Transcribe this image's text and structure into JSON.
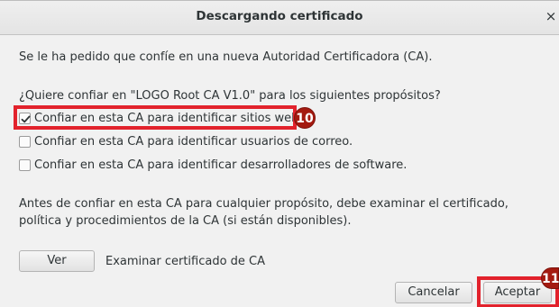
{
  "dialog": {
    "title": "Descargando certificado",
    "close_label": "×",
    "intro": "Se le ha pedido que confíe en una nueva Autoridad Certificadora (CA).",
    "question": "¿Quiere confiar en \"LOGO Root CA V1.0\" para los siguientes propósitos?",
    "options": [
      {
        "label": "Confiar en esta CA para identificar sitios web.",
        "checked": true
      },
      {
        "label": "Confiar en esta CA para identificar usuarios de correo.",
        "checked": false
      },
      {
        "label": "Confiar en esta CA para identificar desarrolladores de software.",
        "checked": false
      }
    ],
    "warning": "Antes de confiar en esta CA para cualquier propósito, debe examinar el certificado, política y procedimientos de la CA (si están disponibles).",
    "view_button": "Ver",
    "view_description": "Examinar certificado de CA",
    "cancel_button": "Cancelar",
    "accept_button": "Aceptar"
  },
  "annotations": {
    "step_10": "10",
    "step_11": "11",
    "highlight_color": "#e2222c",
    "badge_color": "#a41a10"
  }
}
